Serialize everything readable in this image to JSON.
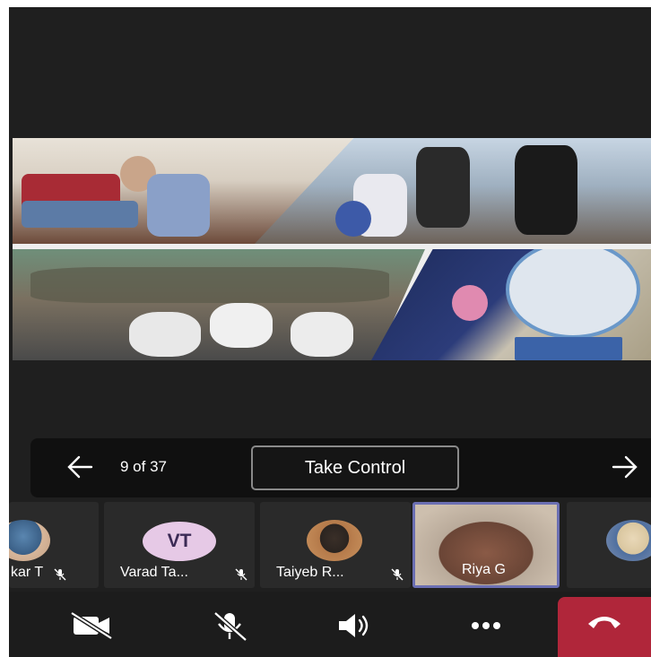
{
  "presenter": {
    "prev_icon": "arrow-left-icon",
    "next_icon": "arrow-right-icon",
    "page_counter": "9 of 37",
    "take_control_label": "Take Control"
  },
  "participants": [
    {
      "name": "kar T",
      "type": "photo",
      "muted": true
    },
    {
      "name": "Varad Ta...",
      "initials": "VT",
      "type": "initials",
      "muted": true
    },
    {
      "name": "Taiyeb R...",
      "type": "photo",
      "muted": true
    },
    {
      "name": "Riya G",
      "type": "video",
      "muted": false,
      "active": true
    },
    {
      "name": "",
      "type": "photo",
      "muted": false
    }
  ],
  "toolbar": {
    "camera_icon": "camera-off-icon",
    "mic_icon": "mic-off-icon",
    "speaker_icon": "speaker-icon",
    "more_icon": "more-options-icon",
    "hangup_icon": "hang-up-icon"
  },
  "colors": {
    "background": "#1f1f1f",
    "control_bar": "#101010",
    "active_tile_border": "#6b6fb3",
    "hangup": "#b0263a",
    "avatar_bg": "#e6c9e6"
  }
}
